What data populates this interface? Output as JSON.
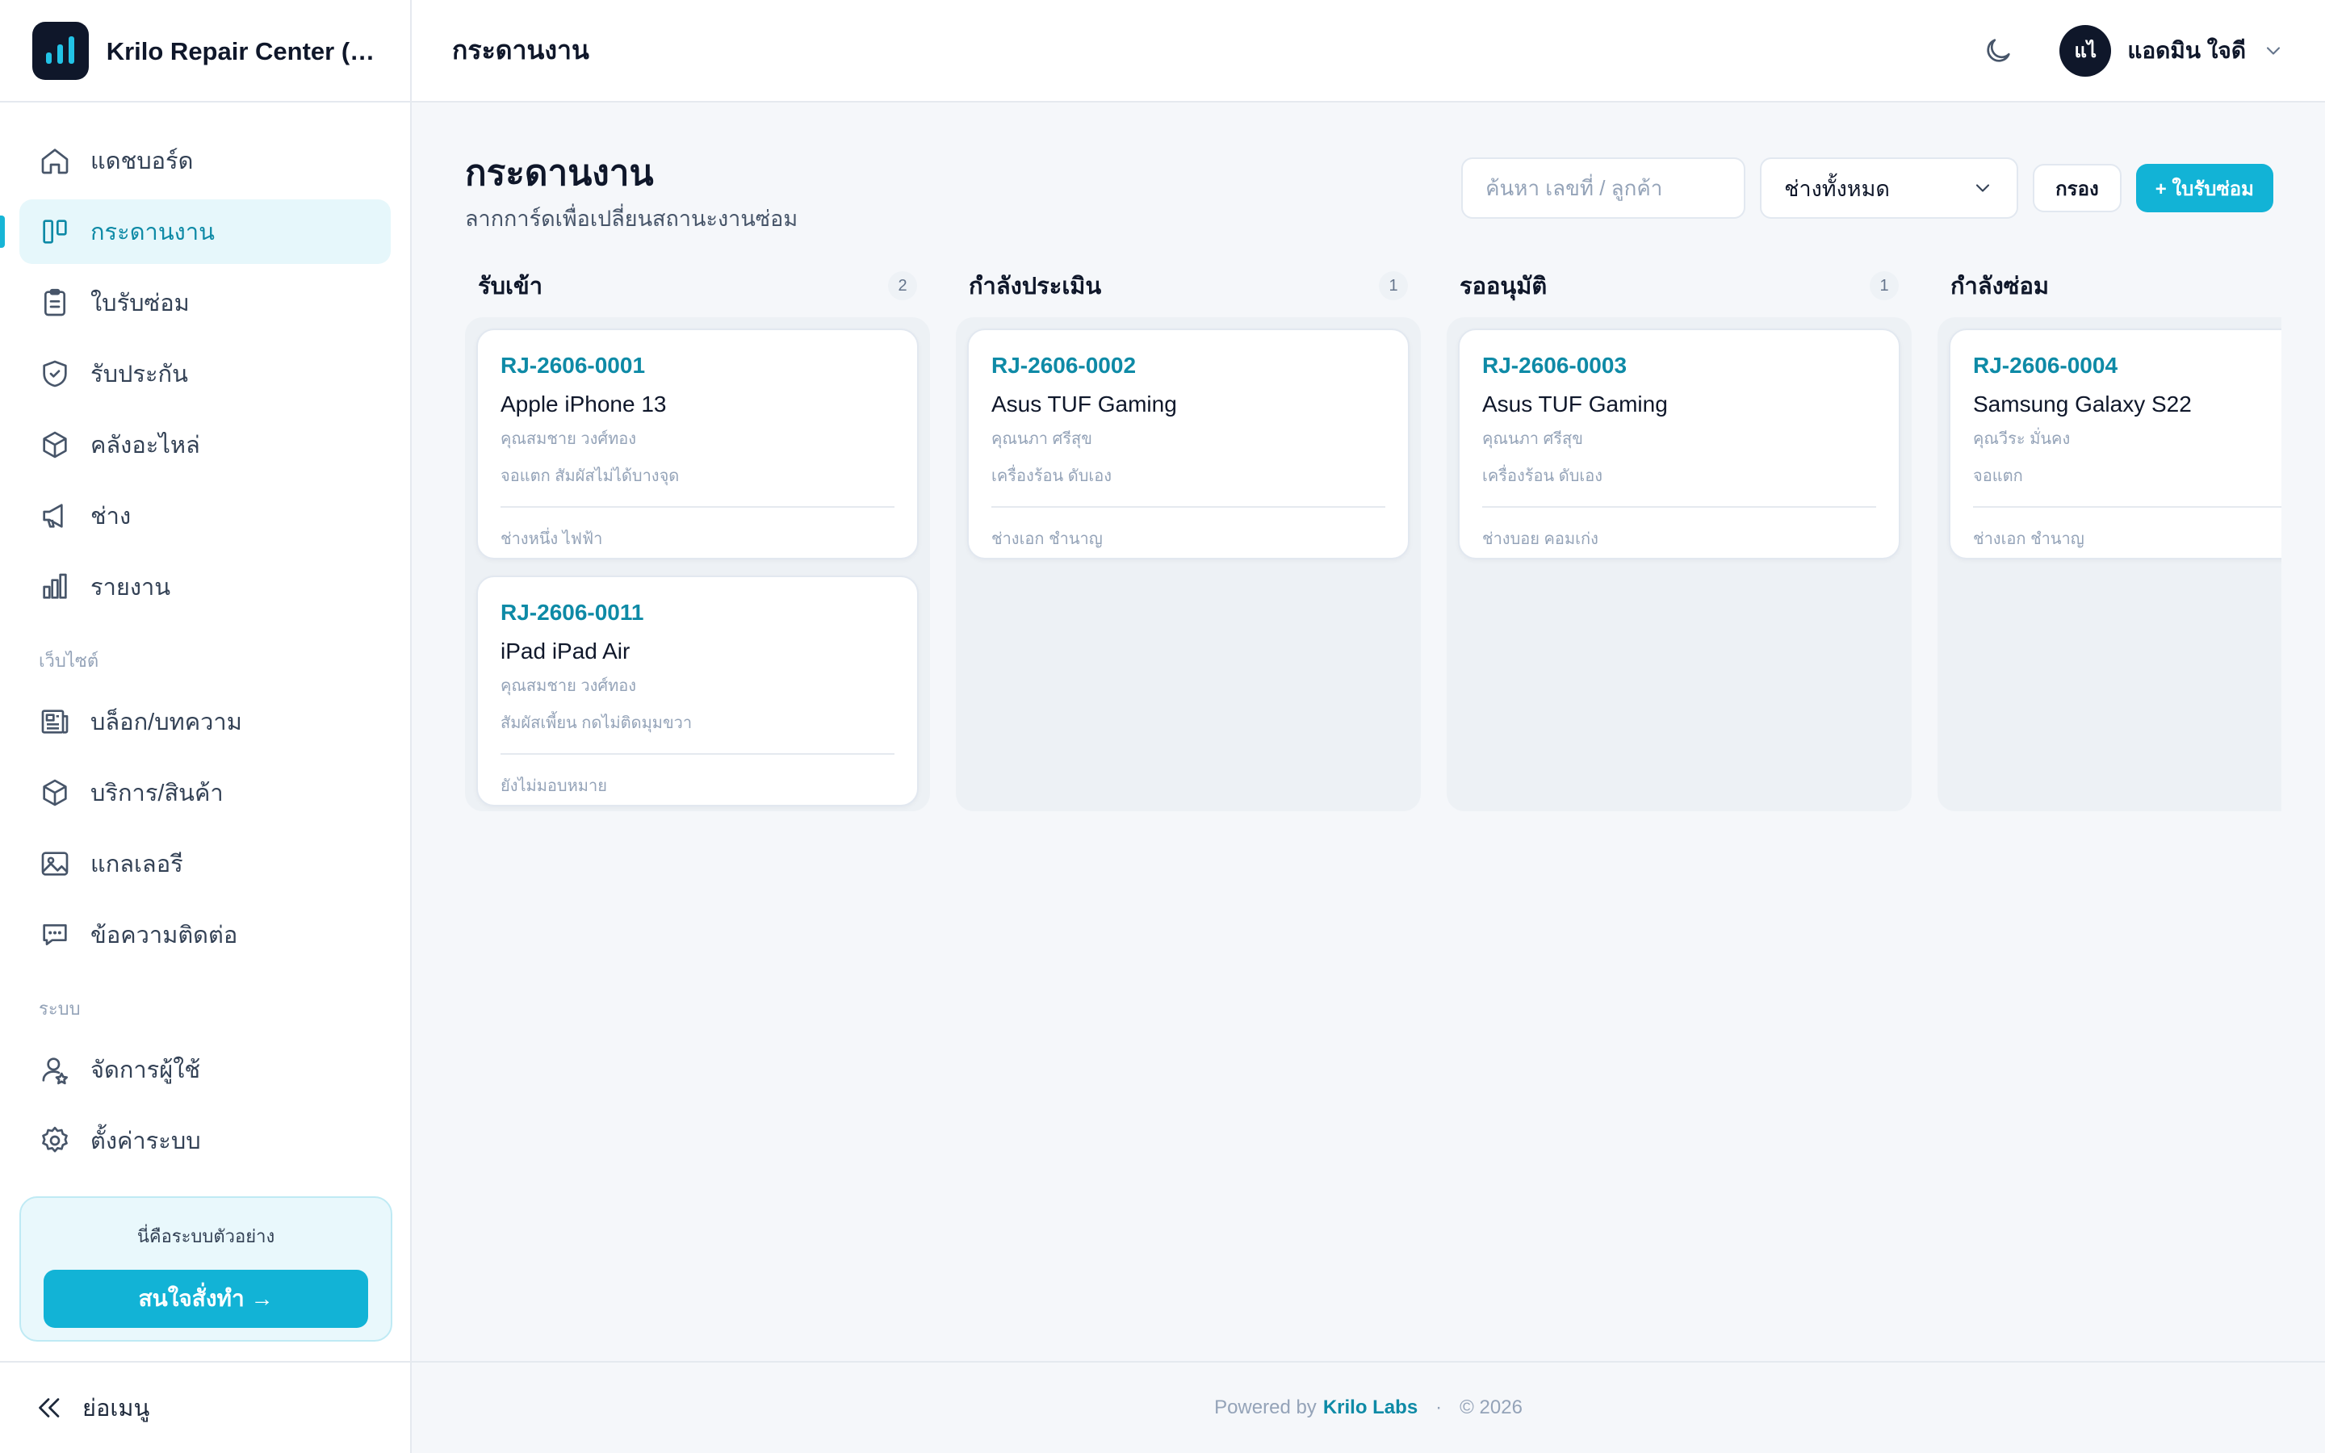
{
  "brand": {
    "name": "Krilo Repair Center (ตั..."
  },
  "sidebar": {
    "main_items": [
      {
        "label": "แดชบอร์ด",
        "icon": "home-icon"
      },
      {
        "label": "กระดานงาน",
        "icon": "kanban-icon",
        "active": true
      },
      {
        "label": "ใบรับซ่อม",
        "icon": "clipboard-icon"
      },
      {
        "label": "รับประกัน",
        "icon": "shield-icon"
      },
      {
        "label": "คลังอะไหล่",
        "icon": "box-icon"
      },
      {
        "label": "ช่าง",
        "icon": "megaphone-icon"
      },
      {
        "label": "รายงาน",
        "icon": "bar-chart-icon"
      }
    ],
    "section_website": "เว็บไซต์",
    "website_items": [
      {
        "label": "บล็อก/บทความ",
        "icon": "newspaper-icon"
      },
      {
        "label": "บริการ/สินค้า",
        "icon": "box-icon"
      },
      {
        "label": "แกลเลอรี",
        "icon": "image-icon"
      },
      {
        "label": "ข้อความติดต่อ",
        "icon": "message-icon"
      }
    ],
    "section_system": "ระบบ",
    "system_items": [
      {
        "label": "จัดการผู้ใช้",
        "icon": "users-icon"
      },
      {
        "label": "ตั้งค่าระบบ",
        "icon": "gear-icon"
      }
    ],
    "promo": {
      "text": "นี่คือระบบตัวอย่าง",
      "button": "สนใจสั่งทำ →"
    },
    "collapse_label": "ย่อเมนู"
  },
  "header": {
    "title": "กระดานงาน",
    "user": {
      "initials": "แไ",
      "name": "แอดมิน ใจดี"
    }
  },
  "page": {
    "title": "กระดานงาน",
    "subtitle": "ลากการ์ดเพื่อเปลี่ยนสถานะงานซ่อม"
  },
  "toolbar": {
    "search_placeholder": "ค้นหา เลขที่ / ลูกค้า",
    "technician_select": "ช่างทั้งหมด",
    "filter_button": "กรอง",
    "new_button": "+ ใบรับซ่อม"
  },
  "board": {
    "columns": [
      {
        "title": "รับเข้า",
        "count": "2",
        "cards": [
          {
            "id": "RJ-2606-0001",
            "device": "Apple iPhone 13",
            "customer": "คุณสมชาย วงศ์ทอง",
            "issue": "จอแตก สัมผัสไม่ได้บางจุด",
            "tech": "ช่างหนึ่ง ไฟฟ้า"
          },
          {
            "id": "RJ-2606-0011",
            "device": "iPad iPad Air",
            "customer": "คุณสมชาย วงศ์ทอง",
            "issue": "สัมผัสเพี้ยน กดไม่ติดมุมขวา",
            "tech": "ยังไม่มอบหมาย"
          }
        ]
      },
      {
        "title": "กำลังประเมิน",
        "count": "1",
        "cards": [
          {
            "id": "RJ-2606-0002",
            "device": "Asus TUF Gaming",
            "customer": "คุณนภา ศรีสุข",
            "issue": "เครื่องร้อน ดับเอง",
            "tech": "ช่างเอก ชำนาญ"
          }
        ]
      },
      {
        "title": "รออนุมัติ",
        "count": "1",
        "cards": [
          {
            "id": "RJ-2606-0003",
            "device": "Asus TUF Gaming",
            "customer": "คุณนภา ศรีสุข",
            "issue": "เครื่องร้อน ดับเอง",
            "tech": "ช่างบอย คอมเก่ง"
          }
        ]
      },
      {
        "title": "กำลังซ่อม",
        "count": "",
        "cards": [
          {
            "id": "RJ-2606-0004",
            "device": "Samsung Galaxy S22",
            "customer": "คุณวีระ มั่นคง",
            "issue": "จอแตก",
            "tech": "ช่างเอก ชำนาญ"
          }
        ]
      }
    ]
  },
  "footer": {
    "powered_by": "Powered by",
    "company": "Krilo Labs",
    "separator": "·",
    "year": "© 2026"
  },
  "colors": {
    "accent": "#12b3d6",
    "accent_text": "#0e8aa6",
    "dark": "#0f172a"
  }
}
